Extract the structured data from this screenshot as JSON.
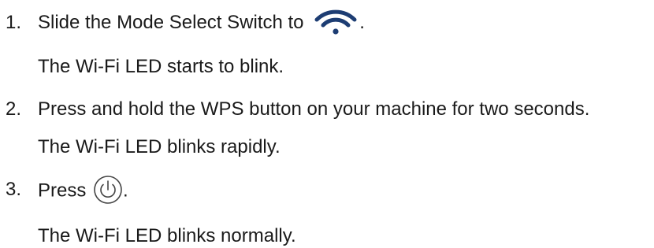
{
  "steps": [
    {
      "number": "1.",
      "instruction_before_icon": "Slide the Mode Select Switch to",
      "icon": "wifi-icon",
      "instruction_after_icon": ".",
      "result": "The Wi-Fi LED starts to blink."
    },
    {
      "number": "2.",
      "instruction": "Press and hold the WPS button on your machine for two seconds.",
      "result": "The Wi-Fi LED blinks rapidly."
    },
    {
      "number": "3.",
      "instruction_before_icon": "Press",
      "icon": "power-button-icon",
      "instruction_after_icon": ".",
      "result": "The Wi-Fi LED blinks normally."
    }
  ]
}
